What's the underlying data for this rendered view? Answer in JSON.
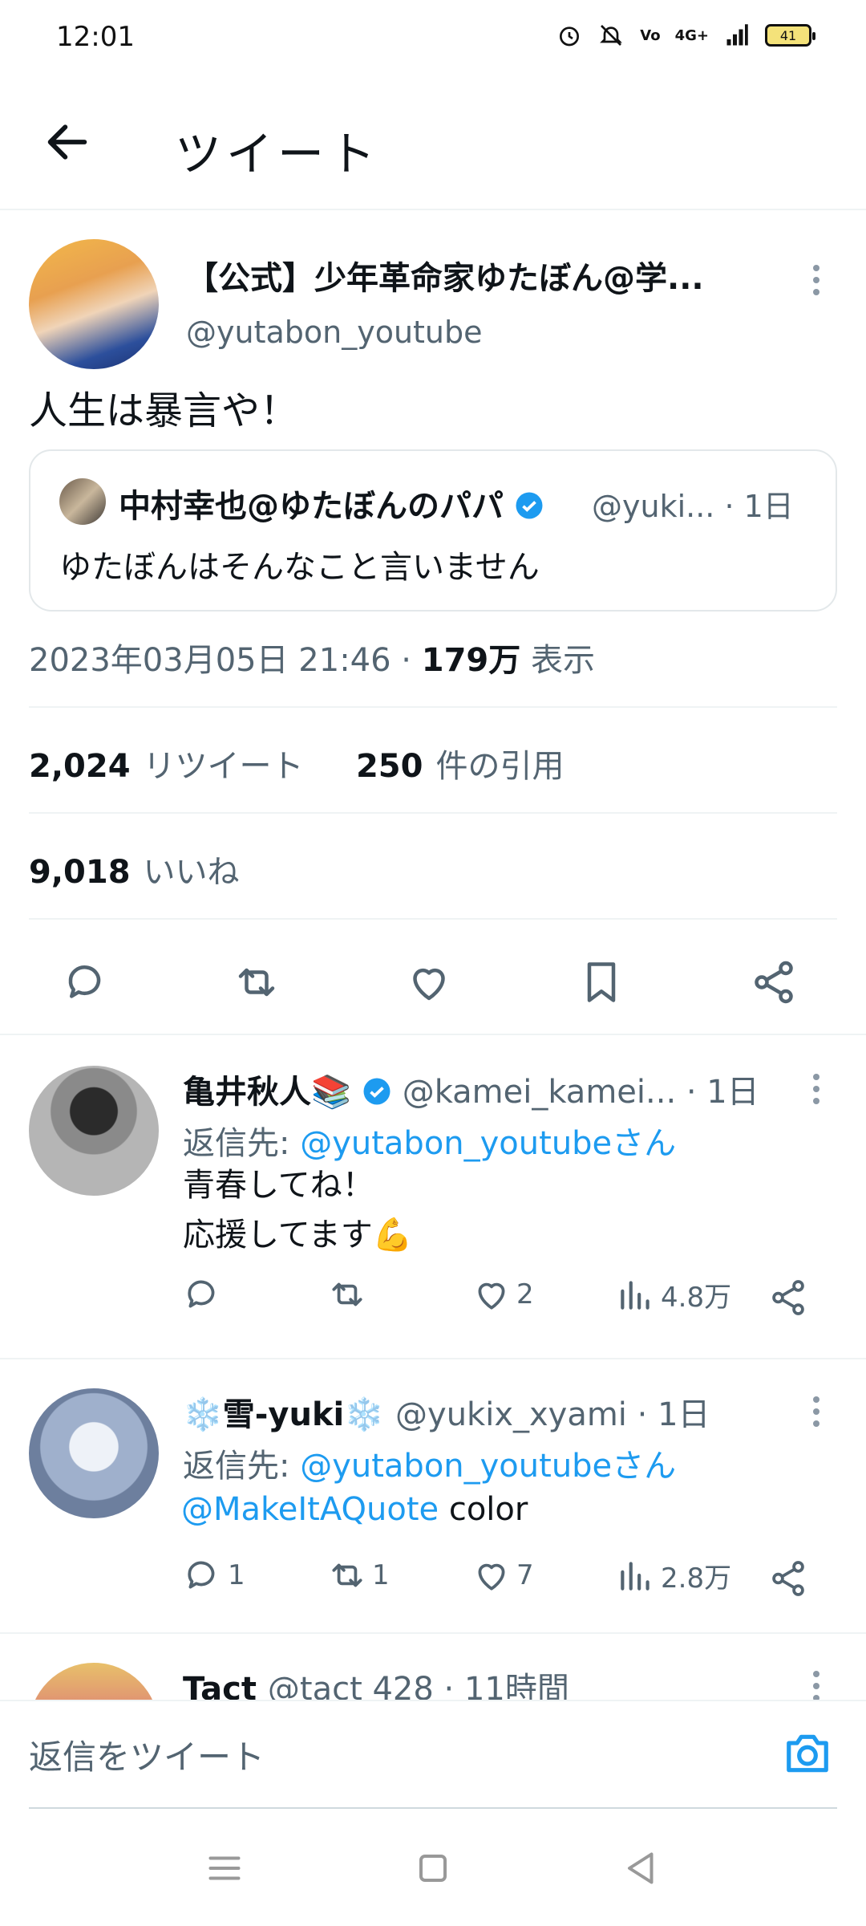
{
  "status": {
    "time": "12:01",
    "battery": "41",
    "network": "4G+"
  },
  "header": {
    "title": "ツイート"
  },
  "tweet": {
    "name": "【公式】少年革命家ゆたぼん@学...",
    "handle": "@yutabon_youtube",
    "text": "人生は暴言や！",
    "quote": {
      "name": "中村幸也@ゆたぼんのパパ",
      "meta": "@yuki... · 1日",
      "text": "ゆたぼんはそんなこと言いません"
    },
    "timestamp": "2023年03月05日 21:46 · ",
    "views_count": "179万",
    "views_label": " 表示",
    "retweets_count": "2,024",
    "retweets_label": "リツイート",
    "quotes_count": "250",
    "quotes_label": "件の引用",
    "likes_count": "9,018",
    "likes_label": "いいね"
  },
  "replies": [
    {
      "name": "亀井秋人📚",
      "meta": "@kamei_kamei... · 1日",
      "replyto_prefix": "返信先: ",
      "replyto_user": "@yutabon_youtubeさん",
      "line1": "青春してね！",
      "line2": "応援してます💪",
      "reply_count": "",
      "retweet_count": "",
      "like_count": "2",
      "view_count": "4.8万"
    },
    {
      "name": "❄️雪-yuki❄️",
      "meta": "@yukix_xyami · 1日",
      "replyto_prefix": "返信先: ",
      "replyto_user": "@yutabon_youtubeさん",
      "mention": "@MakeItAQuote",
      "line1_rest": " color",
      "reply_count": "1",
      "retweet_count": "1",
      "like_count": "7",
      "view_count": "2.8万"
    },
    {
      "name": "Tact",
      "meta": "@tact 428 · 11時間"
    }
  ],
  "compose": {
    "placeholder": "返信をツイート"
  },
  "icons": {
    "back": "arrow-left-icon",
    "reply": "speech-bubble-icon",
    "retweet": "retweet-icon",
    "like": "heart-icon",
    "bookmark": "bookmark-icon",
    "share": "share-icon",
    "views": "bar-chart-icon",
    "camera": "camera-icon"
  },
  "colors": {
    "accent": "#1d9bf0",
    "muted": "#536471",
    "text": "#0f1419"
  }
}
